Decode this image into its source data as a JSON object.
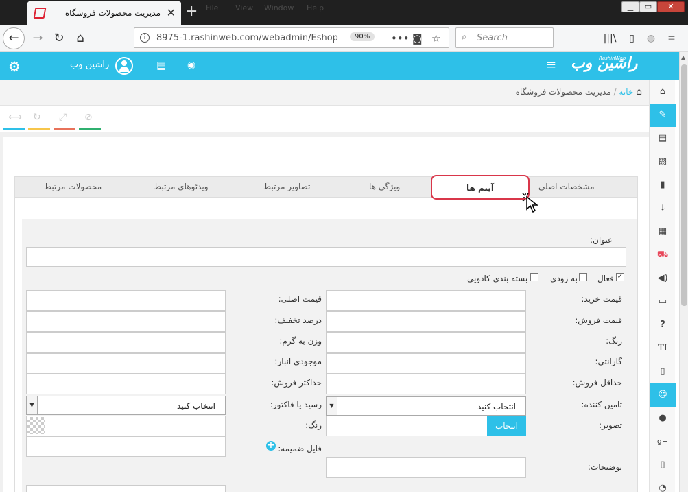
{
  "browser": {
    "tab_title": "مدیریت محصولات فروشگاه",
    "tab_close": "✕",
    "new_tab": "+",
    "ghost_menu": [
      "File",
      "View",
      "Window",
      "Help"
    ],
    "url": "8975-1.rashinweb.com/webadmin/Eshop",
    "zoom": "90%",
    "search_placeholder": "Search"
  },
  "header": {
    "logo_text": "راشین وب",
    "logo_sub": "RashinWeb",
    "user_name": "راشین وب"
  },
  "breadcrumb": {
    "home": "خانه",
    "separator": "/",
    "current": "مدیریت محصولات فروشگاه"
  },
  "tabs": [
    "مشخصات اصلی",
    "آیتم ها",
    "ویژگی ها",
    "تصاویر مرتبط",
    "ویدئوهای مرتبط",
    "محصولات مرتبط"
  ],
  "form": {
    "title_label": "عنوان:",
    "checks": {
      "active": "فعال",
      "soon": "به زودی",
      "gift": "بسته بندی کادویی"
    },
    "col_right": [
      "قیمت خرید:",
      "قیمت فروش:",
      "رنگ:",
      "گارانتی:",
      "حداقل فروش:",
      "تامین کننده:",
      "تصویر:",
      "توضیحات:"
    ],
    "col_left": [
      "قیمت اصلی:",
      "درصد تخفیف:",
      "وزن به گرم:",
      "موجودی انبار:",
      "حداکثر فروش:",
      "رسید یا فاکتور:",
      "رنگ:",
      "فایل ضمیمه:"
    ],
    "select_placeholder": "انتخاب کنید",
    "pick_button": "انتخاب"
  },
  "colors": {
    "accent": "#2ec0e8",
    "highlight": "#d9364a",
    "color_strip": [
      "#2ec0e8",
      "#f7c64b",
      "#e8725a",
      "#2fb06f"
    ]
  }
}
